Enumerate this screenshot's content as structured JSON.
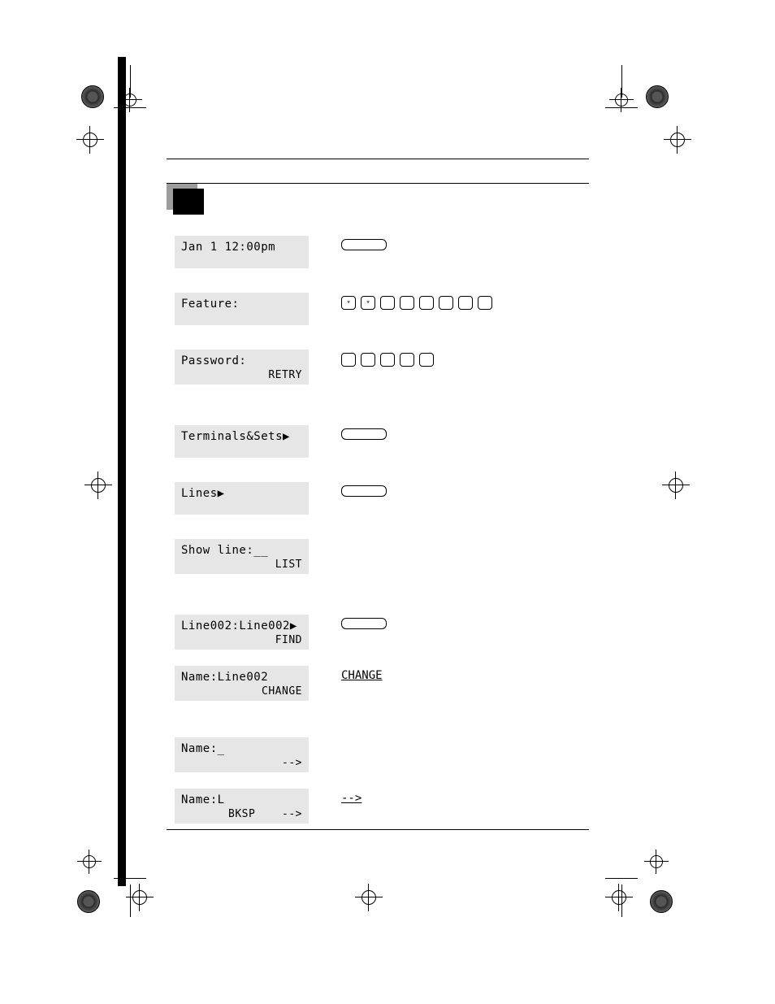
{
  "rows": [
    {
      "line1": "Jan 1  12:00pm",
      "soft": [],
      "rhs": {
        "type": "lozenge"
      }
    },
    {
      "line1": "Feature:",
      "soft": [],
      "rhs": {
        "type": "keys",
        "keys": [
          "*",
          "*",
          "",
          "",
          "",
          "",
          "",
          ""
        ]
      }
    },
    {
      "line1": "Password:",
      "soft": [
        "RETRY"
      ],
      "rhs": {
        "type": "keys",
        "keys": [
          "",
          "",
          "",
          "",
          ""
        ]
      }
    },
    {
      "line1": "Terminals&Sets▶",
      "soft": [],
      "rhs": {
        "type": "lozenge"
      }
    },
    {
      "line1": "Lines▶",
      "soft": [],
      "rhs": {
        "type": "lozenge"
      }
    },
    {
      "line1": "Show line:__",
      "soft": [
        "LIST"
      ],
      "rhs": {
        "type": "none"
      }
    },
    {
      "line1": "Line002:Line002▶",
      "soft": [
        "FIND"
      ],
      "rhs": {
        "type": "lozenge"
      }
    },
    {
      "line1": "Name:Line002",
      "soft": [
        "CHANGE"
      ],
      "rhs": {
        "type": "action",
        "text": "CHANGE"
      }
    },
    {
      "line1": "Name:_",
      "soft": [
        "-->"
      ],
      "rhs": {
        "type": "none"
      }
    },
    {
      "line1": "Name:L",
      "soft": [
        "BKSP",
        "-->"
      ],
      "rhs": {
        "type": "action",
        "text": "-->"
      }
    }
  ],
  "gaps_after": [
    "g30",
    "g30",
    "g50",
    "g30",
    "g30",
    "g50",
    "g20",
    "g45",
    "g20",
    ""
  ]
}
